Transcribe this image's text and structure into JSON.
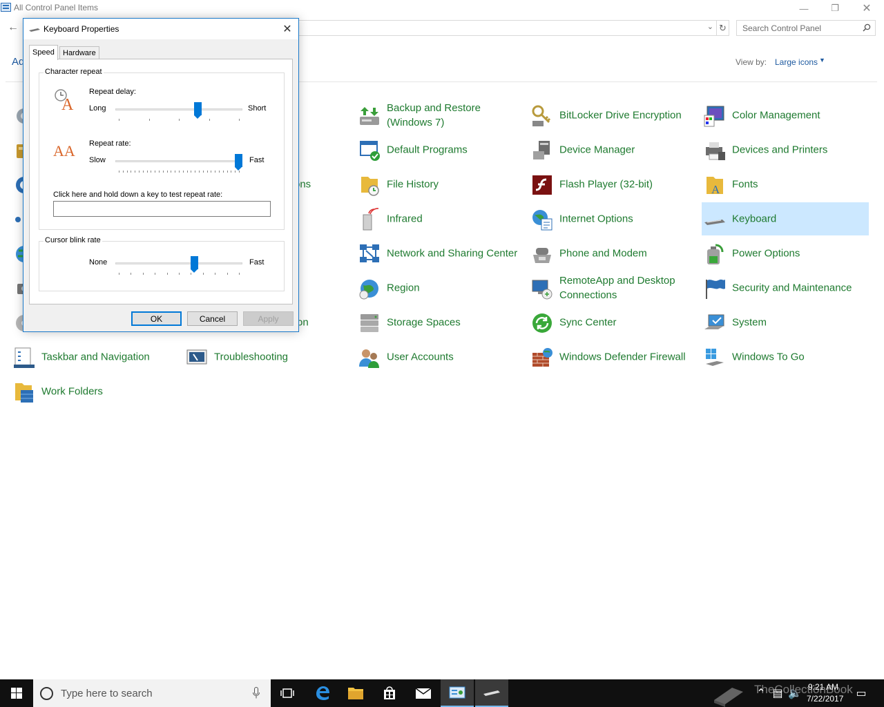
{
  "window": {
    "title": "All Control Panel Items"
  },
  "search": {
    "placeholder": "Search Control Panel"
  },
  "toolbar": {
    "adjust_partial": "Ad",
    "view_by_label": "View by:",
    "view_by_value": "Large icons"
  },
  "items": [
    {
      "label": "",
      "icon": "gear-icon"
    },
    {
      "label": "",
      "icon": "admin-tools-icon"
    },
    {
      "label": "ons",
      "icon": ""
    },
    {
      "label": "",
      "icon": ""
    },
    {
      "label": "on",
      "icon": ""
    },
    {
      "label": "Backup and Restore (Windows 7)",
      "icon": "backup-icon"
    },
    {
      "label": "BitLocker Drive Encryption",
      "icon": "bitlocker-icon"
    },
    {
      "label": "Color Management",
      "icon": "color-management-icon"
    },
    {
      "label": "Default Programs",
      "icon": "default-programs-icon"
    },
    {
      "label": "Device Manager",
      "icon": "device-manager-icon"
    },
    {
      "label": "Devices and Printers",
      "icon": "printer-icon"
    },
    {
      "label": "File History",
      "icon": "file-history-icon"
    },
    {
      "label": "Flash Player (32-bit)",
      "icon": "flash-icon"
    },
    {
      "label": "Fonts",
      "icon": "fonts-icon"
    },
    {
      "label": "Infrared",
      "icon": "infrared-icon"
    },
    {
      "label": "Internet Options",
      "icon": "internet-options-icon"
    },
    {
      "label": "Keyboard",
      "icon": "keyboard-icon"
    },
    {
      "label": "Network and Sharing Center",
      "icon": "network-icon"
    },
    {
      "label": "Phone and Modem",
      "icon": "phone-icon"
    },
    {
      "label": "Power Options",
      "icon": "power-icon"
    },
    {
      "label": "Region",
      "icon": "region-icon"
    },
    {
      "label": "RemoteApp and Desktop Connections",
      "icon": "remoteapp-icon"
    },
    {
      "label": "Security and Maintenance",
      "icon": "flag-icon"
    },
    {
      "label": "Storage Spaces",
      "icon": "storage-icon"
    },
    {
      "label": "Sync Center",
      "icon": "sync-icon"
    },
    {
      "label": "System",
      "icon": "system-icon"
    },
    {
      "label": "Taskbar and Navigation",
      "icon": "taskbar-icon"
    },
    {
      "label": "Troubleshooting",
      "icon": "troubleshooting-icon"
    },
    {
      "label": "User Accounts",
      "icon": "users-icon"
    },
    {
      "label": "Windows Defender Firewall",
      "icon": "firewall-icon"
    },
    {
      "label": "Windows To Go",
      "icon": "windows-to-go-icon"
    },
    {
      "label": "Work Folders",
      "icon": "work-folders-icon"
    }
  ],
  "dialog": {
    "title": "Keyboard Properties",
    "tabs": {
      "speed": "Speed",
      "hardware": "Hardware"
    },
    "char_repeat": {
      "legend": "Character repeat",
      "delay_label": "Repeat delay:",
      "delay_min": "Long",
      "delay_max": "Short",
      "delay_value": 0.66,
      "rate_label": "Repeat rate:",
      "rate_min": "Slow",
      "rate_max": "Fast",
      "rate_value": 1.0,
      "test_label": "Click here and hold down a key to test repeat rate:"
    },
    "cursor_blink": {
      "legend": "Cursor blink rate",
      "min": "None",
      "max": "Fast",
      "value": 0.63
    },
    "buttons": {
      "ok": "OK",
      "cancel": "Cancel",
      "apply": "Apply"
    }
  },
  "taskbar": {
    "search_placeholder": "Type here to search",
    "time": "9:21 AM",
    "date": "7/22/2017",
    "watermark": "TheCollectionBook"
  },
  "colors": {
    "link_green": "#1e7a2f",
    "accent": "#0078d7",
    "selection": "#cce8ff"
  }
}
